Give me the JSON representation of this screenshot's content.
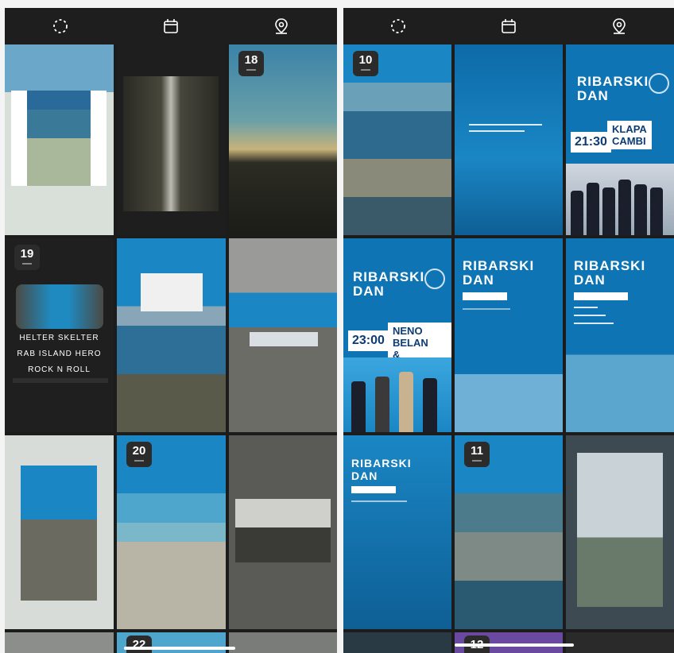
{
  "panel_left": {
    "toolbar": {
      "icons": [
        "loading-icon",
        "calendar-icon",
        "location-pin-icon"
      ]
    },
    "badges": {
      "b18": "18",
      "b19": "19",
      "b20": "20",
      "b22": "22"
    },
    "story19": {
      "line1": "HELTER SKELTER",
      "line2": "RAB ISLAND HERO",
      "line3": "ROCK N ROLL"
    }
  },
  "panel_right": {
    "toolbar": {
      "icons": [
        "loading-icon",
        "calendar-icon",
        "location-pin-icon"
      ]
    },
    "badges": {
      "b10": "10",
      "b11": "11",
      "b12": "12"
    },
    "event": {
      "title_line1": "RIBARSKI",
      "title_line2": "DAN",
      "time1": "21:30",
      "act1_line1": "KLAPA",
      "act1_line2": "CAMBI",
      "time2": "23:00",
      "act2_line1": "NENO BELAN",
      "act2_line2": "& FIUMENS"
    }
  },
  "colors": {
    "ocean_blue": "#1a86c4",
    "deep_blue": "#0a5f9a",
    "dark": "#1c1c1c"
  }
}
